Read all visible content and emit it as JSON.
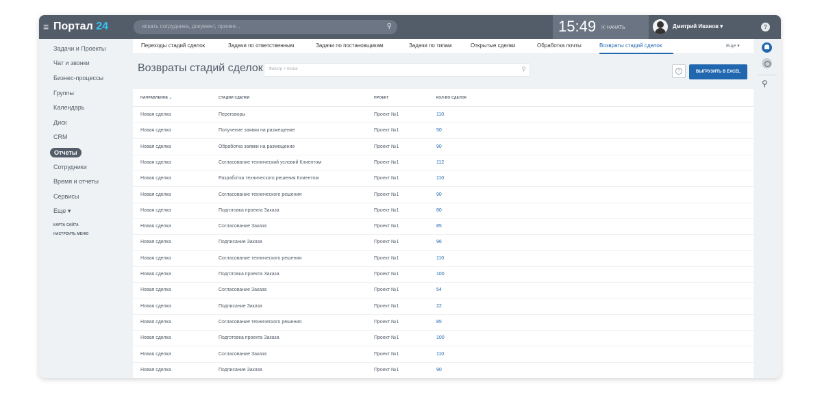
{
  "topbar": {
    "logo_text": "Портал",
    "logo_num": "24",
    "search_placeholder": "искать сотрудника, документ, прочее...",
    "time": "15:49",
    "start_label": "⦿ НАЧАТЬ",
    "user_name": "Дмитрий Иванов",
    "user_chevron": "▾",
    "help": "?"
  },
  "sidebar": {
    "items": [
      "Задачи и Проекты",
      "Чат и звонки",
      "Бизнес-процессы",
      "Группы",
      "Календарь",
      "Диск",
      "CRM",
      "Отчеты",
      "Сотрудники",
      "Время и отчеты",
      "Сервисы",
      "Еще ▾"
    ],
    "active_index": 7,
    "site_map": "КАРТА САЙТА",
    "configure_menu": "НАСТРОИТЬ МЕНЮ"
  },
  "tabs": [
    "Переходы стадий сделок",
    "Задачи по ответственным",
    "Задачи по постановщикам",
    "Задачи по типам",
    "Открытые сделки",
    "Обработка почты",
    "Возвраты стадий сделок"
  ],
  "tabs_more": "Еще ▾",
  "page": {
    "title": "Возвраты стадий сделок",
    "filter_placeholder": "Фильтр + поиск",
    "excel_button": "ВЫГРУЗИТЬ В EXCEL"
  },
  "table": {
    "headers": [
      "НАПРАВЛЕНИЕ ⌄",
      "СТАДИИ СДЕЛКИ",
      "ПРОЕКТ",
      "КОЛ-ВО СДЕЛОК"
    ],
    "rows": [
      [
        "Новая сделка",
        "Переговоры",
        "Проект №1",
        "110"
      ],
      [
        "Новая сделка",
        "Получение заявки на размещение",
        "Проект №1",
        "50"
      ],
      [
        "Новая сделка",
        "Обработка заявки на размещение",
        "Проект №1",
        "90"
      ],
      [
        "Новая сделка",
        "Согласование технический условий Клиентом",
        "Проект №1",
        "112"
      ],
      [
        "Новая сделка",
        "Разработка технического решения Клиентом",
        "Проект №1",
        "110"
      ],
      [
        "Новая сделка",
        "Согласование технического решения",
        "Проект №1",
        "90"
      ],
      [
        "Новая сделка",
        "Подготовка проекта Заказа",
        "Проект №1",
        "80"
      ],
      [
        "Новая сделка",
        "Согласование Заказа",
        "Проект №1",
        "85"
      ],
      [
        "Новая сделка",
        "Подписание Заказа",
        "Проект №1",
        "96"
      ],
      [
        "Новая сделка",
        "Согласование технического решения",
        "Проект №1",
        "110"
      ],
      [
        "Новая сделка",
        "Подготовка проекта Заказа",
        "Проект №1",
        "100"
      ],
      [
        "Новая сделка",
        "Согласование Заказа",
        "Проект №1",
        "54"
      ],
      [
        "Новая сделка",
        "Подписание Заказа",
        "Проект №1",
        "22"
      ],
      [
        "Новая сделка",
        "Согласование технического решения",
        "Проект №1",
        "85"
      ],
      [
        "Новая сделка",
        "Подготовка проекта Заказа",
        "Проект №1",
        "100"
      ],
      [
        "Новая сделка",
        "Согласование Заказа",
        "Проект №1",
        "110"
      ],
      [
        "Новая сделка",
        "Подписание Заказа",
        "Проект №1",
        "90"
      ]
    ]
  },
  "colors": {
    "topbar": "#535c69",
    "accent": "#2067b0",
    "logo_num": "#2fc6f6"
  }
}
